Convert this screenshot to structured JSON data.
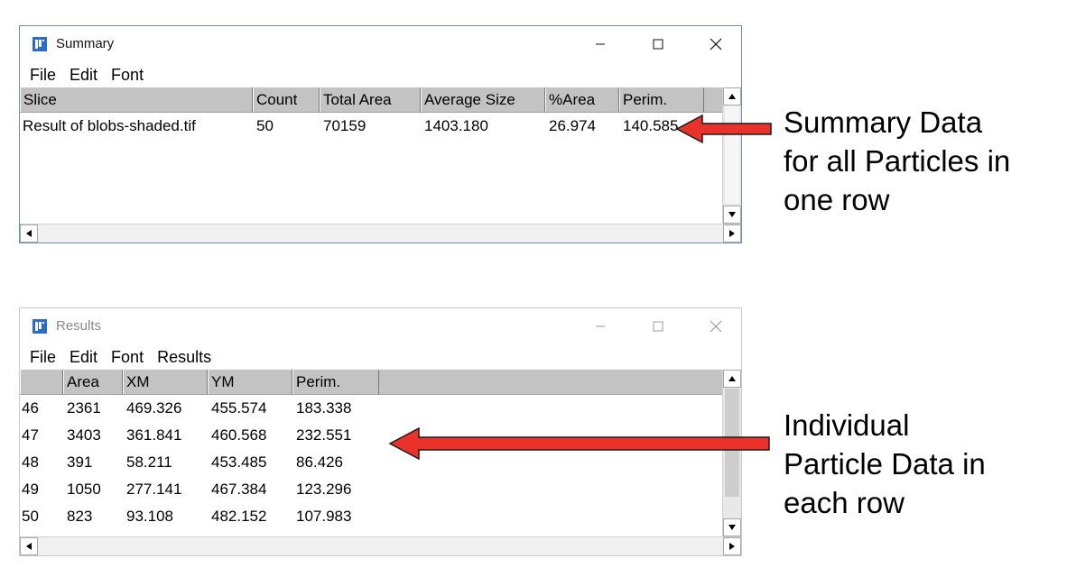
{
  "summary_window": {
    "title": "Summary",
    "menu": [
      "File",
      "Edit",
      "Font"
    ],
    "columns": [
      "Slice",
      "Count",
      "Total Area",
      "Average Size",
      "%Area",
      "Perim."
    ],
    "rows": [
      [
        "Result of blobs-shaded.tif",
        "50",
        "70159",
        "1403.180",
        "26.974",
        "140.585"
      ]
    ]
  },
  "results_window": {
    "title": "Results",
    "menu": [
      "File",
      "Edit",
      "Font",
      "Results"
    ],
    "columns": [
      "",
      "Area",
      "XM",
      "YM",
      "Perim."
    ],
    "rows": [
      [
        "46",
        "2361",
        "469.326",
        "455.574",
        "183.338"
      ],
      [
        "47",
        "3403",
        "361.841",
        "460.568",
        "232.551"
      ],
      [
        "48",
        "391",
        "58.211",
        "453.485",
        "86.426"
      ],
      [
        "49",
        "1050",
        "277.141",
        "467.384",
        "123.296"
      ],
      [
        "50",
        "823",
        "93.108",
        "482.152",
        "107.983"
      ]
    ]
  },
  "annotations": {
    "summary": [
      "Summary Data",
      "for all Particles in",
      "one row"
    ],
    "results": [
      "Individual",
      "Particle Data in",
      "each row"
    ]
  },
  "colors": {
    "arrow_fill": "#e8322a",
    "arrow_outline": "#1a1a1a",
    "header_bg": "#c3c3c3",
    "active_border": "#6c8fb8"
  }
}
